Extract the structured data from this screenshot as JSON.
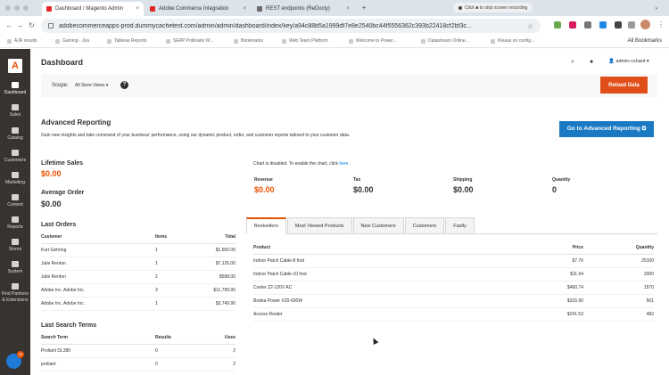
{
  "browser": {
    "tabs": [
      {
        "label": "Dashboard / Magento Admin",
        "active": true
      },
      {
        "label": "Adobe Commerce Integration",
        "active": false
      },
      {
        "label": "REST endpoints (ReDocly)",
        "active": false
      }
    ],
    "new_tab": "+",
    "recording": "Click ■ to stop screen recording",
    "url": "adobecommerceapps-prod.dummycachetest.com/admin/admin/dashboard/index/key/a94c88b5a1999df7e8e2540bc44f5556362c393b22418cf2bf3c...",
    "bookmarks": [
      "AJR results",
      "Gaming - Jira",
      "Tableau Reports",
      "SERP Pollinator M...",
      "Bookmarks",
      "Web Team Platform",
      "Welcome to Power...",
      "Datastream Online...",
      "Kleaas on config..."
    ],
    "all_bookmarks": "All Bookmarks",
    "icons": [
      "back-icon",
      "forward-icon",
      "reload-icon",
      "star-icon",
      "extension-icon",
      "kebab-icon"
    ]
  },
  "sidebar": {
    "logo": "A",
    "items": [
      {
        "label": "Dashboard",
        "icon": "dashboard-icon",
        "active": true
      },
      {
        "label": "Sales",
        "icon": "dollar-icon"
      },
      {
        "label": "Catalog",
        "icon": "box-icon"
      },
      {
        "label": "Customers",
        "icon": "people-icon"
      },
      {
        "label": "Marketing",
        "icon": "megaphone-icon"
      },
      {
        "label": "Content",
        "icon": "layout-icon"
      },
      {
        "label": "Reports",
        "icon": "bar-chart-icon"
      },
      {
        "label": "Stores",
        "icon": "store-icon"
      },
      {
        "label": "System",
        "icon": "gear-icon"
      },
      {
        "label": "Find Partners & Extensions",
        "icon": "puzzle-icon"
      }
    ],
    "chat_badge": "30"
  },
  "header": {
    "title": "Dashboard",
    "user": "admin-cshant ▾"
  },
  "scope": {
    "label": "Scope:",
    "value": "All Store Views ▾",
    "help": "?",
    "reload_button": "Reload Data"
  },
  "advanced": {
    "title": "Advanced Reporting",
    "description": "Gain new insights and take command of your business' performance, using our dynamic product, order, and customer reports tailored to your customer data.",
    "button": "Go to Advanced Reporting ⧉"
  },
  "stats": {
    "lifetime_sales_label": "Lifetime Sales",
    "lifetime_sales_value": "$0.00",
    "avg_order_label": "Average Order",
    "avg_order_value": "$0.00"
  },
  "chart": {
    "message": "Chart is disabled. To enable the chart, click",
    "link": "here."
  },
  "totals": [
    {
      "label": "Revenue",
      "value": "$0.00"
    },
    {
      "label": "Tax",
      "value": "$0.00"
    },
    {
      "label": "Shipping",
      "value": "$0.00"
    },
    {
      "label": "Quantity",
      "value": "0"
    }
  ],
  "last_orders": {
    "title": "Last Orders",
    "columns": [
      "Customer",
      "Items",
      "Total"
    ],
    "rows": [
      [
        "Kurt Gehring",
        "1",
        "$1,650.00"
      ],
      [
        "Julie Renton",
        "1",
        "$7,125.00"
      ],
      [
        "Julie Renton",
        "2",
        "$598.00"
      ],
      [
        "Adobe Inc. Adobe Inc.",
        "3",
        "$11,799.90"
      ],
      [
        "Adobe Inc. Adobe Inc.",
        "1",
        "$3,749.90"
      ]
    ]
  },
  "last_search": {
    "title": "Last Search Terms",
    "columns": [
      "Search Term",
      "Results",
      "Uses"
    ],
    "rows": [
      [
        "Proliant DL380",
        "0",
        "2"
      ],
      [
        "proliant",
        "0",
        "2"
      ]
    ]
  },
  "tabs": [
    "Bestsellers",
    "Most Viewed Products",
    "New Customers",
    "Customers",
    "Fastly"
  ],
  "bestsellers": {
    "columns": [
      "Product",
      "Price",
      "Quantity"
    ],
    "rows": [
      [
        "Indoor Patch Cable-8 foot",
        "$7.76",
        "25100"
      ],
      [
        "Indoor Patch Cable-10 foot",
        "$11.64",
        "2000"
      ],
      [
        "Cooler Z2-120V AC",
        "$460.74",
        "1570"
      ],
      [
        "Bodea Power X20-650W",
        "$315.90",
        "501"
      ],
      [
        "Access Router",
        "$241.53",
        "482"
      ]
    ]
  }
}
